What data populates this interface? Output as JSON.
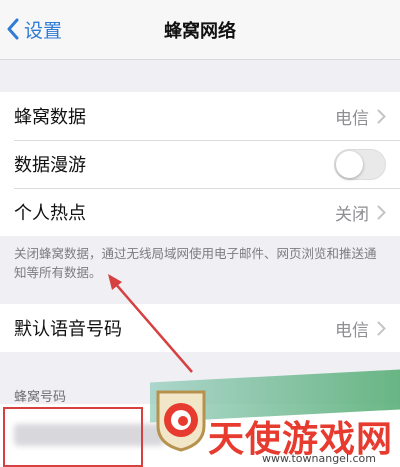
{
  "navbar": {
    "back_label": "设置",
    "title": "蜂窝网络"
  },
  "rows": {
    "cellular_data": {
      "label": "蜂窝数据",
      "value": "电信"
    },
    "data_roaming": {
      "label": "数据漫游",
      "toggle_on": false
    },
    "personal_hotspot": {
      "label": "个人热点",
      "value": "关闭"
    },
    "default_voice_line": {
      "label": "默认语音号码",
      "value": "电信"
    }
  },
  "footnote": "关闭蜂窝数据，通过无线局域网使用电子邮件、网页浏览和推送通知等所有数据。",
  "section_header": "蜂窝号码",
  "annotation_color": "#d64040",
  "watermark": {
    "name": "天使游戏网",
    "url": "www.townangel.com"
  }
}
